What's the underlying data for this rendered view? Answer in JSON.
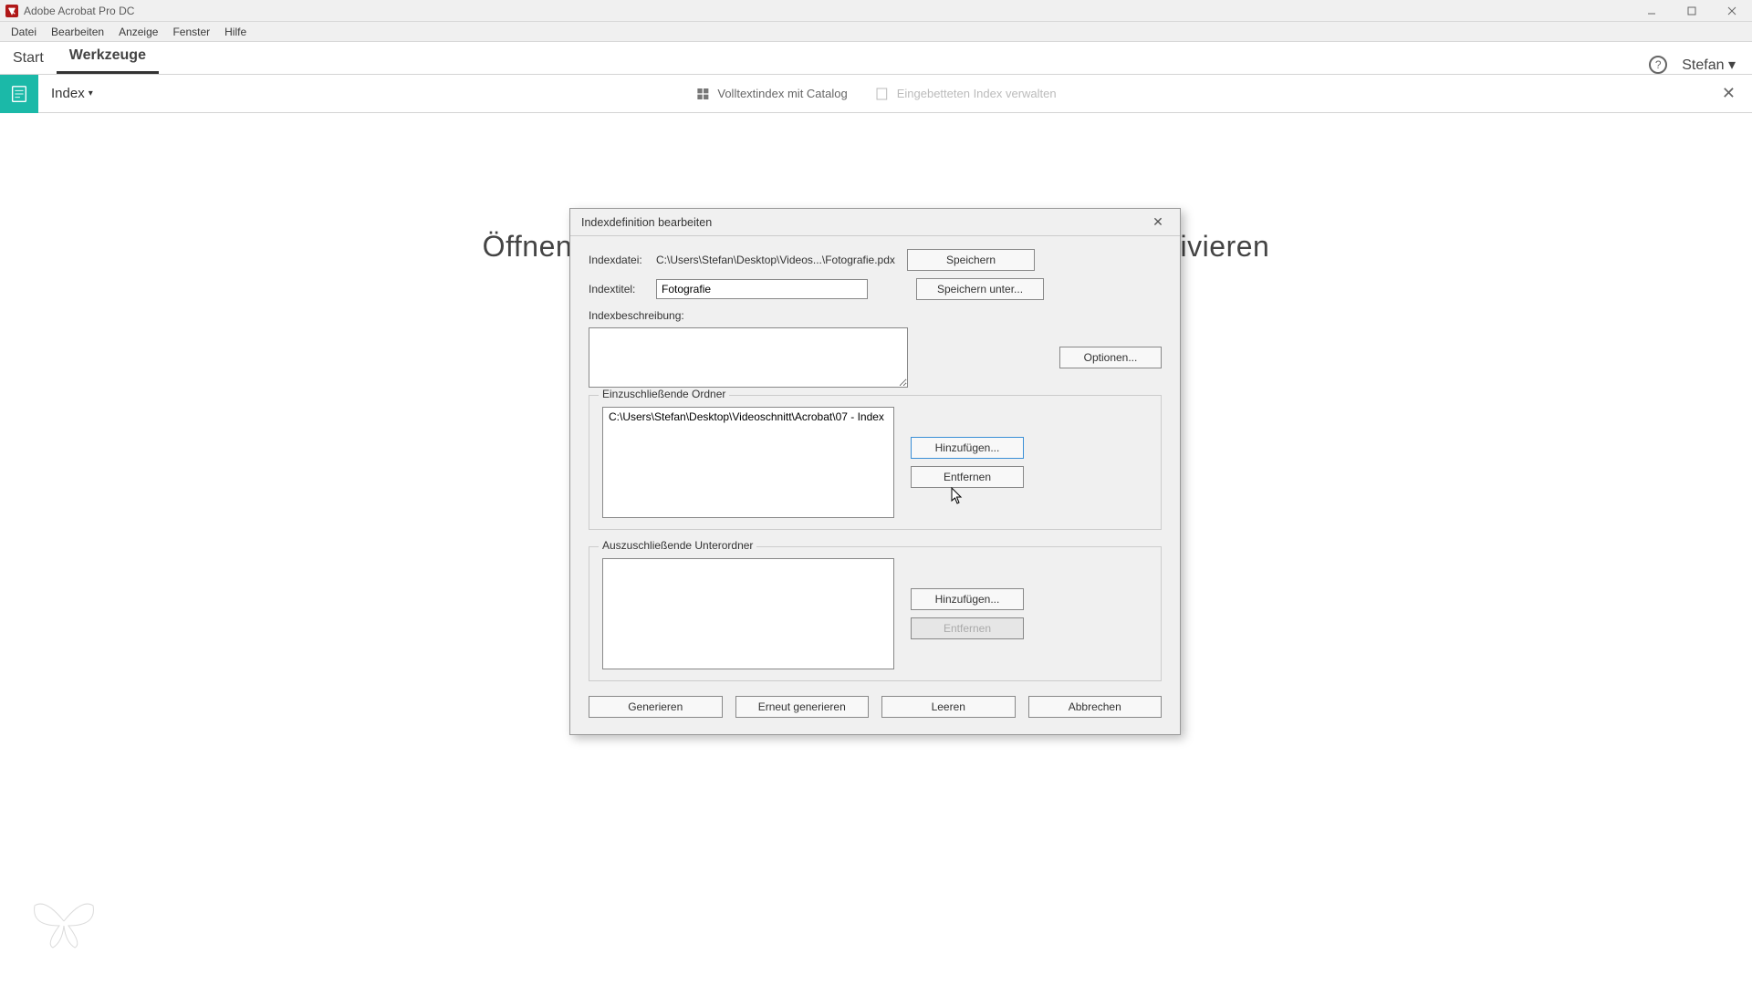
{
  "app": {
    "title": "Adobe Acrobat Pro DC",
    "user": "Stefan"
  },
  "menubar": [
    "Datei",
    "Bearbeiten",
    "Anzeige",
    "Fenster",
    "Hilfe"
  ],
  "tabs": {
    "start": "Start",
    "tools": "Werkzeuge"
  },
  "toolbar": {
    "label": "Index",
    "opt1": "Volltextindex mit Catalog",
    "opt2": "Eingebetteten Index verwalten"
  },
  "bg_hint": "Öffnen Sie eine Datei, um weitere Funktionen zu aktivieren",
  "dialog": {
    "title": "Indexdefinition bearbeiten",
    "indexdatei_label": "Indexdatei:",
    "indexdatei_value": "C:\\Users\\Stefan\\Desktop\\Videos...\\Fotografie.pdx",
    "indextitel_label": "Indextitel:",
    "indextitel_value": "Fotografie",
    "speichern": "Speichern",
    "speichern_unter": "Speichern unter...",
    "indexbeschreibung_label": "Indexbeschreibung:",
    "indexbeschreibung_value": "",
    "optionen": "Optionen...",
    "include_group": "Einzuschließende Ordner",
    "include_items": [
      "C:\\Users\\Stefan\\Desktop\\Videoschnitt\\Acrobat\\07 - Index"
    ],
    "hinzufuegen": "Hinzufügen...",
    "entfernen": "Entfernen",
    "exclude_group": "Auszuschließende Unterordner",
    "generieren": "Generieren",
    "erneut": "Erneut generieren",
    "leeren": "Leeren",
    "abbrechen": "Abbrechen"
  }
}
